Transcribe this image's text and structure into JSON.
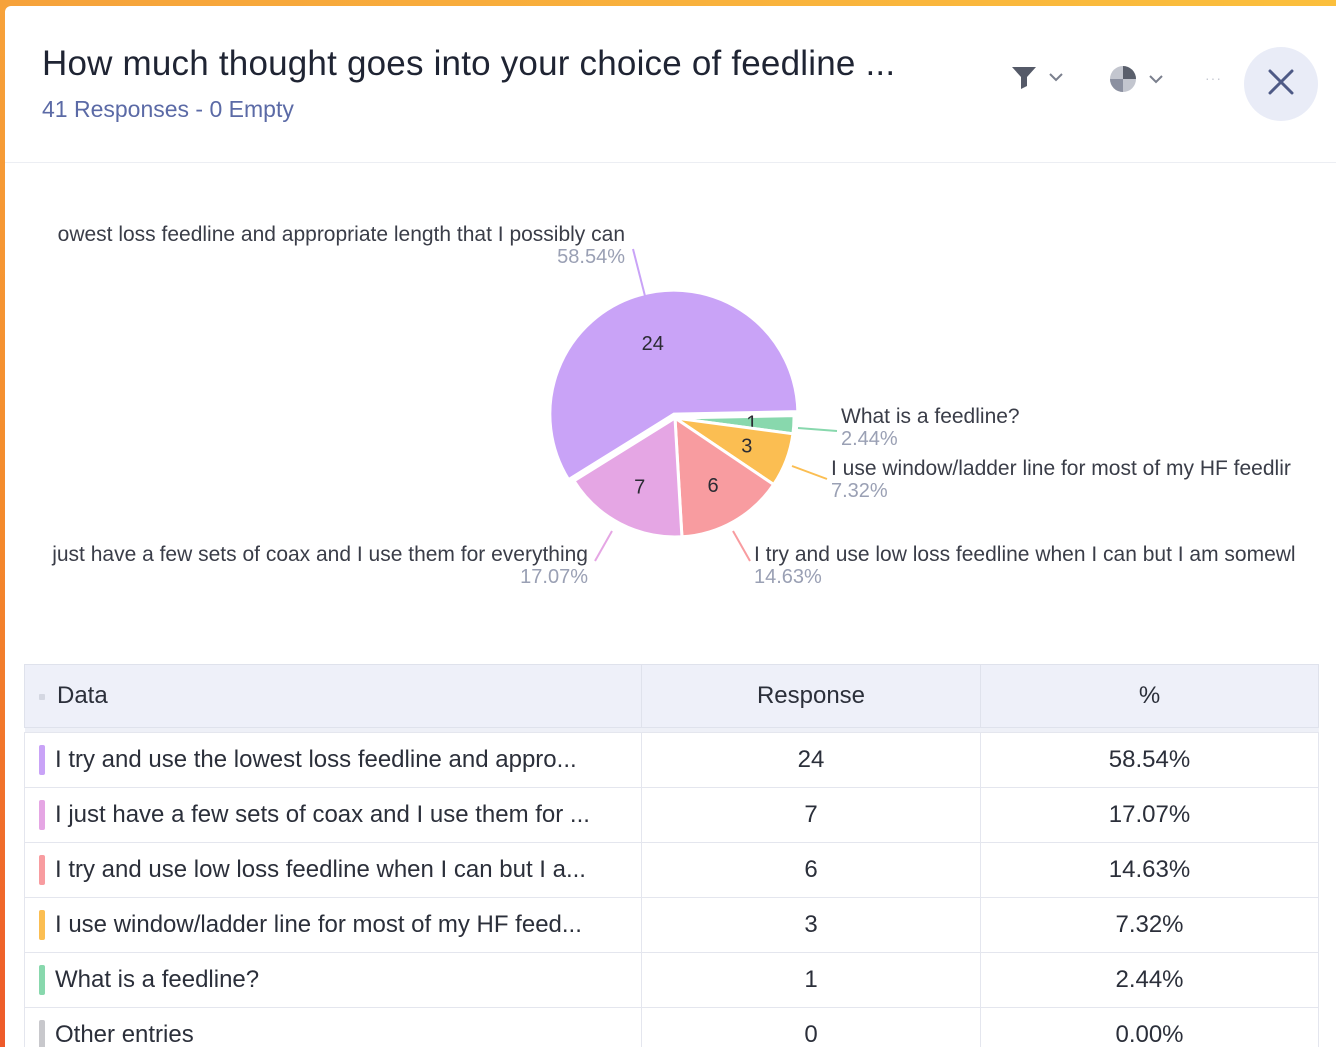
{
  "header": {
    "title": "How much thought goes into your choice of feedline ...",
    "subtitle": "41 Responses - 0 Empty",
    "more_label": "···"
  },
  "icons": {
    "filter": "filter-icon",
    "chart_type": "pie-chart-icon",
    "close": "close-icon"
  },
  "chart_data": {
    "type": "pie",
    "total": 41,
    "slices": [
      {
        "label": "owest loss feedline and appropriate length that I possibly can",
        "value": 24,
        "percent": "58.54%",
        "color": "#c9a3f7"
      },
      {
        "label": "What is a feedline?",
        "value": 1,
        "percent": "2.44%",
        "color": "#88d8ad"
      },
      {
        "label": "I use window/ladder line for most of my HF feedlir",
        "value": 3,
        "percent": "7.32%",
        "color": "#fbbe52"
      },
      {
        "label": "I try and use low loss feedline when I can but I am somewl",
        "value": 6,
        "percent": "14.63%",
        "color": "#f89ca0"
      },
      {
        "label": "just have a few sets of coax and I use them for everything",
        "value": 7,
        "percent": "17.07%",
        "color": "#e5a6e4"
      }
    ]
  },
  "table": {
    "headers": {
      "data": "Data",
      "response": "Response",
      "percent": "%"
    },
    "rows": [
      {
        "label": "I try and use the lowest loss feedline and appro...",
        "response": "24",
        "percent": "58.54%",
        "color": "#c9a3f7"
      },
      {
        "label": "I just have a few sets of coax and I use them for ...",
        "response": "7",
        "percent": "17.07%",
        "color": "#e5a6e4"
      },
      {
        "label": "I try and use low loss feedline when I can but I a...",
        "response": "6",
        "percent": "14.63%",
        "color": "#f89ca0"
      },
      {
        "label": "I use window/ladder line for most of my HF feed...",
        "response": "3",
        "percent": "7.32%",
        "color": "#fbbe52"
      },
      {
        "label": "What is a feedline?",
        "response": "1",
        "percent": "2.44%",
        "color": "#88d8ad"
      },
      {
        "label": "Other entries",
        "response": "0",
        "percent": "0.00%",
        "color": "#c8c8cc"
      }
    ]
  }
}
